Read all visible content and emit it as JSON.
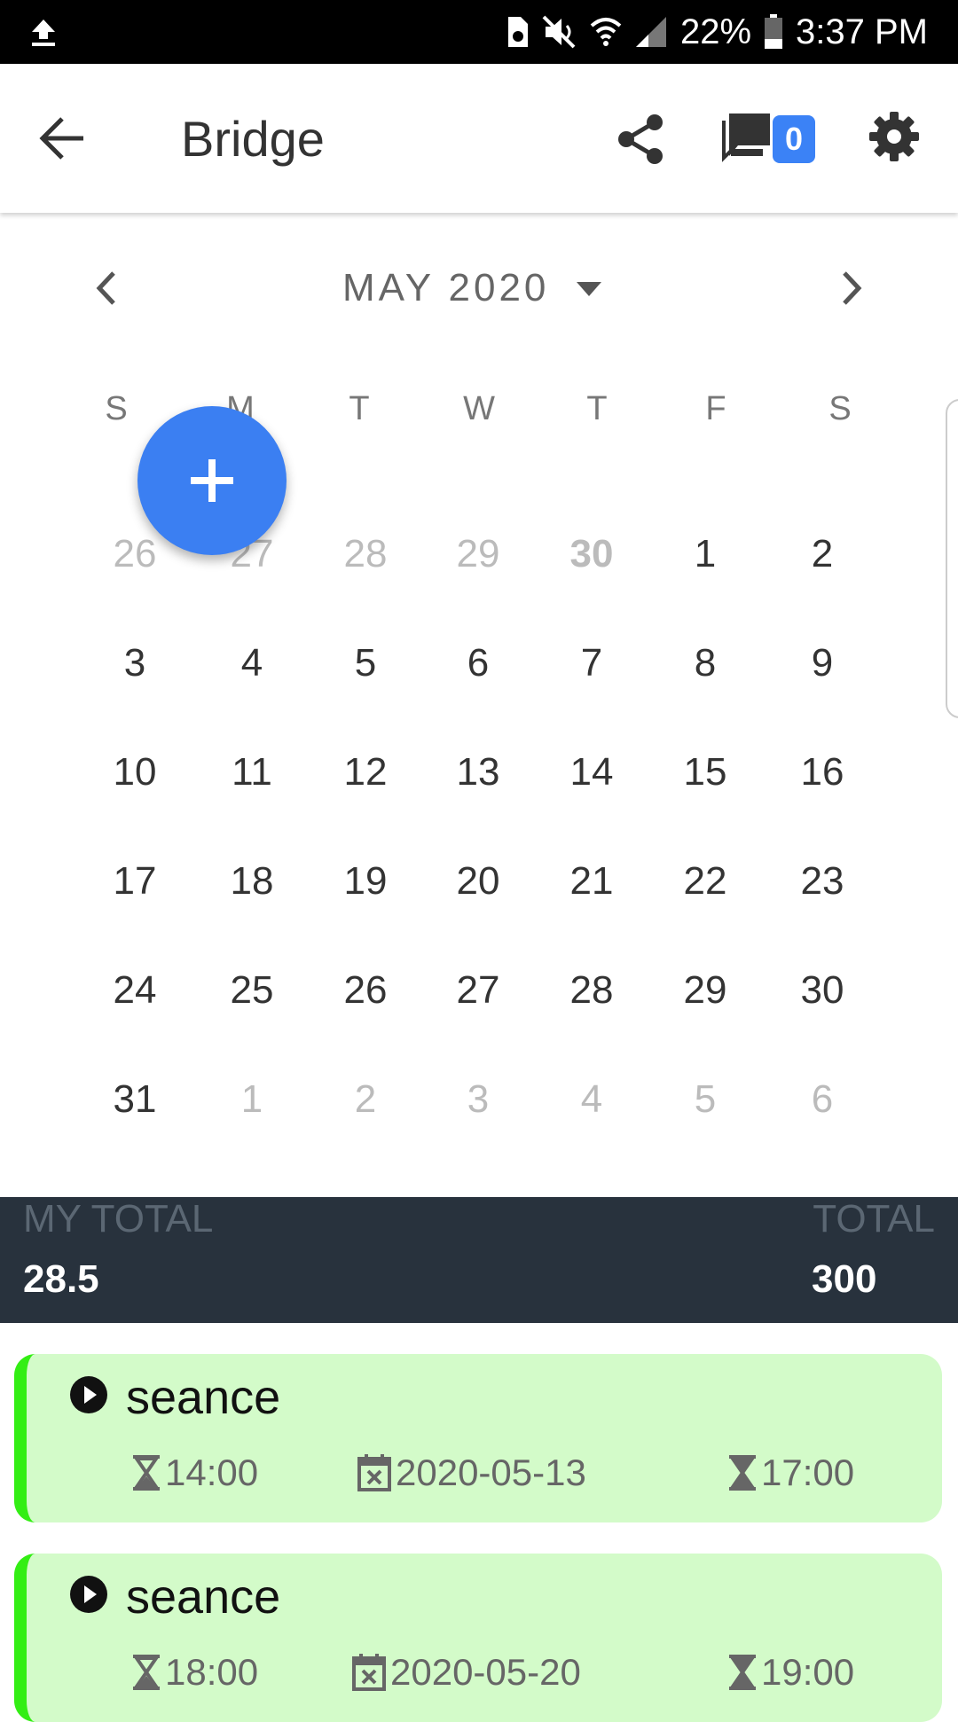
{
  "status_bar": {
    "battery_pct": "22%",
    "time": "3:37 PM"
  },
  "app_bar": {
    "title": "Bridge",
    "chat_count": "0"
  },
  "calendar": {
    "month_label": "MAY 2020",
    "weekdays": [
      "S",
      "M",
      "T",
      "W",
      "T",
      "F",
      "S"
    ],
    "weeks": [
      [
        {
          "d": "26",
          "t": "other"
        },
        {
          "d": "27",
          "t": "other"
        },
        {
          "d": "28",
          "t": "other"
        },
        {
          "d": "29",
          "t": "other"
        },
        {
          "d": "30",
          "t": "other-bold"
        },
        {
          "d": "1",
          "t": "cur"
        },
        {
          "d": "2",
          "t": "cur"
        }
      ],
      [
        {
          "d": "3",
          "t": "cur"
        },
        {
          "d": "4",
          "t": "cur"
        },
        {
          "d": "5",
          "t": "cur"
        },
        {
          "d": "6",
          "t": "cur"
        },
        {
          "d": "7",
          "t": "cur"
        },
        {
          "d": "8",
          "t": "cur"
        },
        {
          "d": "9",
          "t": "cur"
        }
      ],
      [
        {
          "d": "10",
          "t": "cur"
        },
        {
          "d": "11",
          "t": "cur"
        },
        {
          "d": "12",
          "t": "cur"
        },
        {
          "d": "13",
          "t": "cur"
        },
        {
          "d": "14",
          "t": "cur"
        },
        {
          "d": "15",
          "t": "cur"
        },
        {
          "d": "16",
          "t": "cur"
        }
      ],
      [
        {
          "d": "17",
          "t": "cur"
        },
        {
          "d": "18",
          "t": "cur"
        },
        {
          "d": "19",
          "t": "cur"
        },
        {
          "d": "20",
          "t": "cur"
        },
        {
          "d": "21",
          "t": "cur"
        },
        {
          "d": "22",
          "t": "cur"
        },
        {
          "d": "23",
          "t": "cur"
        }
      ],
      [
        {
          "d": "24",
          "t": "cur"
        },
        {
          "d": "25",
          "t": "cur"
        },
        {
          "d": "26",
          "t": "cur"
        },
        {
          "d": "27",
          "t": "cur"
        },
        {
          "d": "28",
          "t": "cur"
        },
        {
          "d": "29",
          "t": "cur"
        },
        {
          "d": "30",
          "t": "cur"
        }
      ],
      [
        {
          "d": "31",
          "t": "cur"
        },
        {
          "d": "1",
          "t": "other"
        },
        {
          "d": "2",
          "t": "other"
        },
        {
          "d": "3",
          "t": "other"
        },
        {
          "d": "4",
          "t": "other"
        },
        {
          "d": "5",
          "t": "other"
        },
        {
          "d": "6",
          "t": "other"
        }
      ]
    ]
  },
  "totals": {
    "my_total_label": "MY TOTAL",
    "my_total_value": "28.5",
    "total_label": "TOTAL",
    "total_value": "300"
  },
  "sessions": [
    {
      "name": "seance",
      "start": "14:00",
      "date": "2020-05-13",
      "end": "17:00"
    },
    {
      "name": "seance",
      "start": "18:00",
      "date": "2020-05-20",
      "end": "19:00"
    }
  ],
  "colors": {
    "accent": "#3b82f6",
    "fab": "#3b7ff2",
    "totals_bg": "#28323d",
    "card_bg": "#d3fbc9",
    "card_stripe": "#33ee14"
  }
}
